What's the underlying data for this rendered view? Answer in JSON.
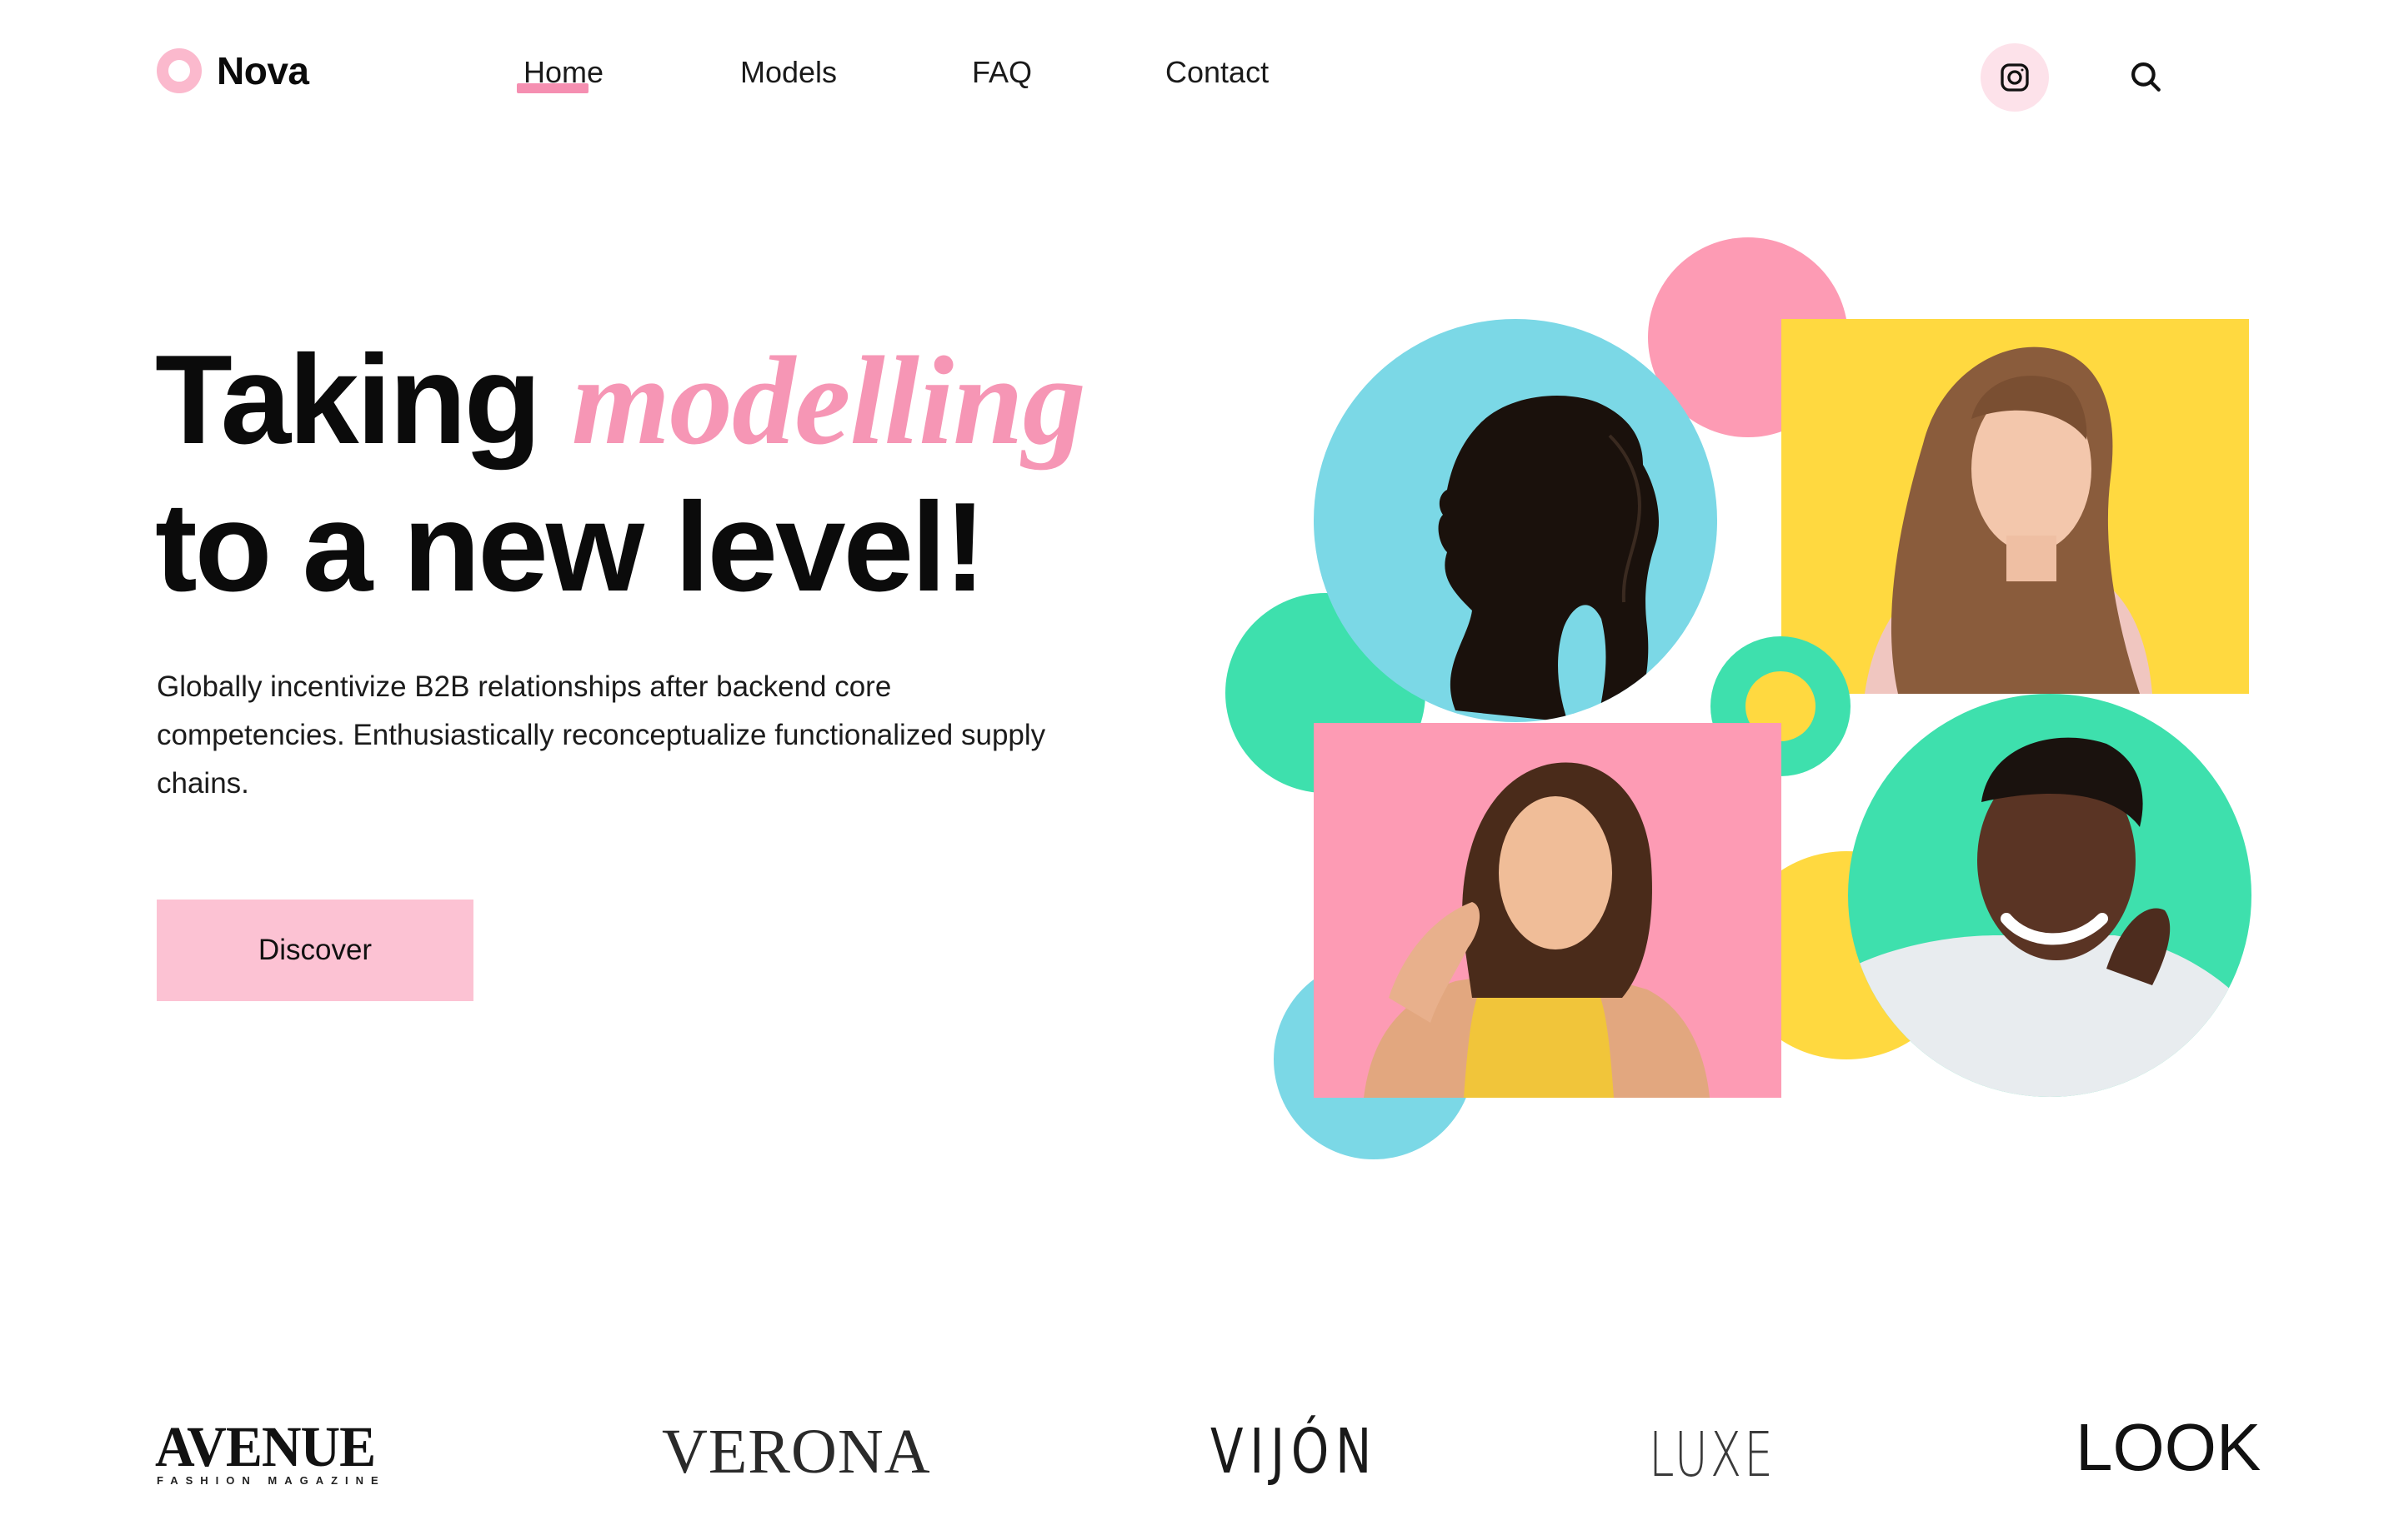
{
  "brand": {
    "name": "Nova"
  },
  "nav": {
    "items": [
      {
        "label": "Home",
        "active": true
      },
      {
        "label": "Models",
        "active": false
      },
      {
        "label": "FAQ",
        "active": false
      },
      {
        "label": "Contact",
        "active": false
      }
    ]
  },
  "header_actions": {
    "instagram_icon": "instagram-icon",
    "search_icon": "search-icon"
  },
  "hero": {
    "title_part1": "Taking",
    "title_accent": "modelling",
    "title_part2": "to a new level!",
    "description": "Globally incentivize B2B relationships after backend core competencies. Enthusiastically reconceptualize functionalized supply chains.",
    "cta_label": "Discover"
  },
  "colors": {
    "pink": "#fd9bb4",
    "pink_light": "#fcc2d3",
    "cyan": "#7bd8e6",
    "green": "#3ee0ad",
    "yellow": "#ffd940",
    "accent_text": "#f696b5"
  },
  "partners": {
    "avenue": "AVENUE",
    "avenue_sub": "FASHION MAGAZINE",
    "verona": "VERONA",
    "vijon": "VIJÓN",
    "luxe": "LUXE",
    "look": "LOOK"
  }
}
